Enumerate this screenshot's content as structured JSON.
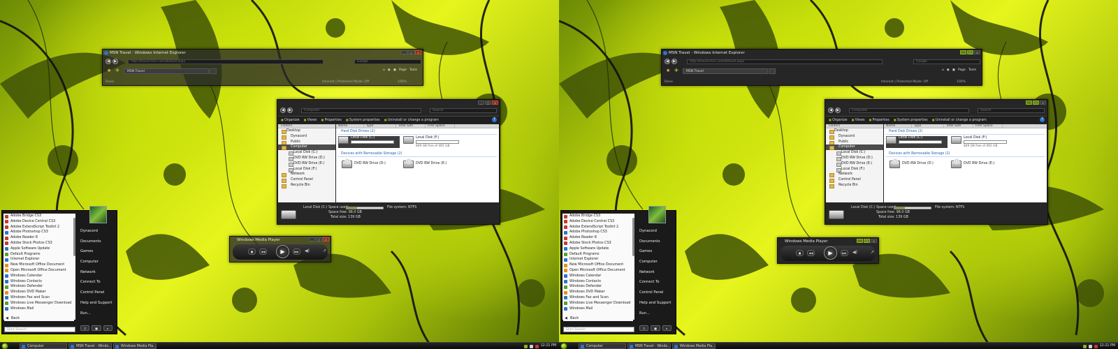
{
  "ie": {
    "title": "MSN Travel - Windows Internet Explorer",
    "address": "http://travel.msn.com/default.aspx",
    "search_placeholder": "Google",
    "tab": "MSN Travel",
    "page_menu": "Page",
    "tools_menu": "Tools",
    "status_left": "Done",
    "status_zone": "Internet | Protected Mode: Off",
    "zoom": "100%"
  },
  "explorer": {
    "address": "Computer",
    "search_placeholder": "Search",
    "commands": [
      "Organize",
      "Views",
      "Properties",
      "System properties",
      "Uninstall or change a program"
    ],
    "nav_header": "Folders",
    "nav_items": [
      {
        "label": "Desktop",
        "level": 1
      },
      {
        "label": "Dynacord",
        "level": 2
      },
      {
        "label": "Public",
        "level": 2
      },
      {
        "label": "Computer",
        "level": 2
      },
      {
        "label": "Local Disk (C:)",
        "level": 3
      },
      {
        "label": "DVD RW Drive (D:)",
        "level": 3
      },
      {
        "label": "DVD RW Drive (E:)",
        "level": 3
      },
      {
        "label": "Local Disk (F:)",
        "level": 3
      },
      {
        "label": "Network",
        "level": 2
      },
      {
        "label": "Control Panel",
        "level": 2
      },
      {
        "label": "Recycle Bin",
        "level": 2
      }
    ],
    "columns": [
      "Name",
      "Type",
      "Total Size",
      "Free Space"
    ],
    "group_hdd": "Hard Disk Drives (2)",
    "group_removable": "Devices with Removable Storage (2)",
    "drive_c": {
      "label": "Local Disk (C:)",
      "used_fraction": 0.29
    },
    "drive_f": {
      "label": "Local Disk (F:)",
      "free": "849 GB free of 465 GB",
      "used_fraction": 0.02
    },
    "drive_d": "DVD RW Drive (D:)",
    "drive_e": "DVD RW Drive (E:)",
    "details": {
      "name": "Local Disk (C:)",
      "space_used_label": "Space used:",
      "space_free": "Space free: 98.0 GB",
      "total_size": "Total size: 139 GB",
      "file_system": "File system: NTFS",
      "used_fraction": 0.29
    }
  },
  "wmp": {
    "title": "Windows Media Player"
  },
  "start_menu": {
    "programs": [
      "Adobe Bridge CS3",
      "Adobe Device Central CS3",
      "Adobe ExtendScript Toolkit 2",
      "Adobe Photoshop CS3",
      "Adobe Reader 8",
      "Adobe Stock Photos CS3",
      "Apple Software Update",
      "Default Programs",
      "Internet Explorer",
      "New Microsoft Office Document",
      "Open Microsoft Office Document",
      "Windows Calendar",
      "Windows Contacts",
      "Windows Defender",
      "Windows DVD Maker",
      "Windows Fax and Scan",
      "Windows Live Messenger Download",
      "Windows Mail"
    ],
    "back": "Back",
    "search_placeholder": "Start Search",
    "places": [
      "Dynacord",
      "Documents",
      "Games",
      "Computer",
      "Network",
      "Connect To",
      "Control Panel",
      "Help and Support",
      "Run..."
    ]
  },
  "taskbar": {
    "items": [
      "Computer",
      "MSN Travel - Windo...",
      "Windows Media Pla..."
    ],
    "clock": "12:21 PM"
  },
  "colors": {
    "accent_green": "#8cb21c",
    "chrome_dark": "#262626",
    "wallpaper_lime": "#d4ec14"
  }
}
